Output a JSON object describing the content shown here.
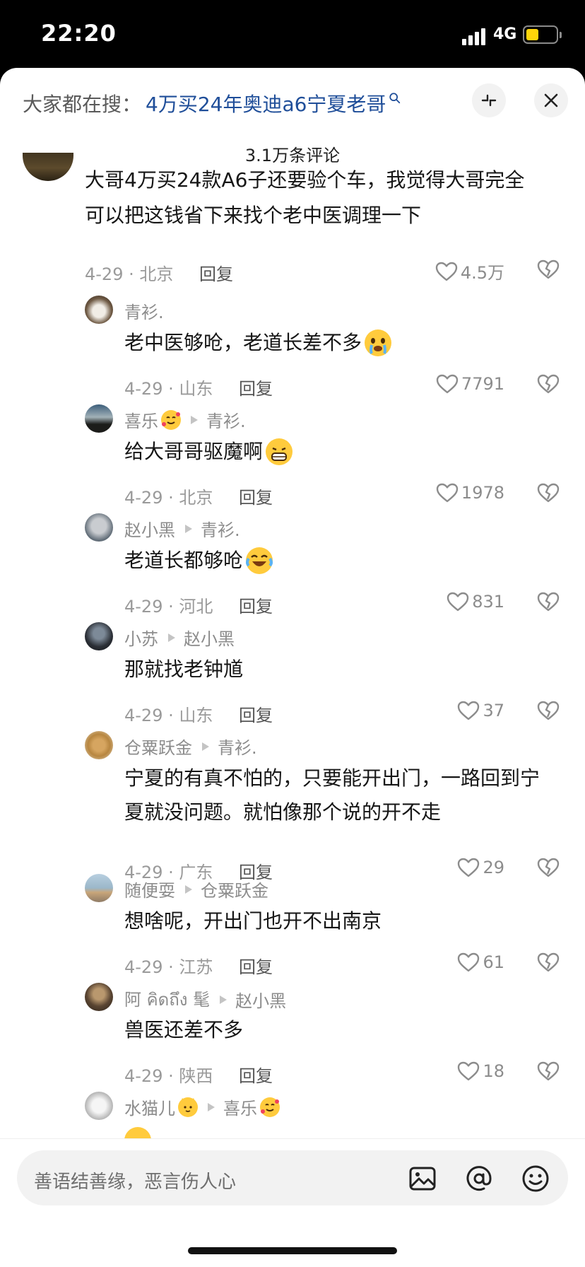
{
  "status": {
    "time": "22:20",
    "network": "4G"
  },
  "header": {
    "search_prefix": "大家都在搜：",
    "search_query": "4万买24年奥迪a6宁夏老哥",
    "comment_count": "3.1万条评论"
  },
  "comments": [
    {
      "user": "",
      "reply_to": "",
      "text": "大哥4万买24款A6子还要验个车，我觉得大哥完全",
      "text2": "可以把这钱省下来找个老中医调理一下",
      "date_loc": "4-29 · 北京",
      "reply": "回复",
      "likes": "4.5万"
    },
    {
      "user": "青衫.",
      "reply_to": "",
      "text": "老中医够呛，老道长差不多",
      "date_loc": "4-29 · 山东",
      "reply": "回复",
      "likes": "7791"
    },
    {
      "user": "喜乐",
      "reply_to": "青衫.",
      "text": "给大哥哥驱魔啊",
      "date_loc": "4-29 · 北京",
      "reply": "回复",
      "likes": "1978"
    },
    {
      "user": "赵小黑",
      "reply_to": "青衫.",
      "text": "老道长都够呛",
      "date_loc": "4-29 · 河北",
      "reply": "回复",
      "likes": "831"
    },
    {
      "user": "小苏",
      "reply_to": "赵小黑",
      "text": "那就找老钟馗",
      "date_loc": "4-29 · 山东",
      "reply": "回复",
      "likes": "37"
    },
    {
      "user": "仓粟跃金",
      "reply_to": "青衫.",
      "text": "宁夏的有真不怕的，只要能开出门，一路回到宁",
      "text2": "夏就没问题。就怕像那个说的开不走",
      "date_loc": "4-29 · 广东",
      "reply": "回复",
      "likes": "29"
    },
    {
      "user": "随便耍",
      "reply_to": "仓粟跃金",
      "text": "想啥呢，开出门也开不出南京",
      "date_loc": "4-29 · 江苏",
      "reply": "回复",
      "likes": "61"
    },
    {
      "user": "阿 คิดถึง 髦",
      "reply_to": "赵小黑",
      "text": "兽医还差不多",
      "date_loc": "4-29 · 陕西",
      "reply": "回复",
      "likes": "18"
    },
    {
      "user": "水猫儿",
      "reply_to": "喜乐"
    }
  ],
  "input": {
    "placeholder": "善语结善缘，恶言伤人心"
  },
  "icons": [
    "search-icon",
    "collapse-icon",
    "close-icon",
    "heart-icon",
    "dislike-icon",
    "play-arrow-icon",
    "image-icon",
    "mention-icon",
    "emoji-icon"
  ],
  "colors": {
    "query_blue": "#1f4e99",
    "battery_yellow": "#ffd60a",
    "gray_meta": "#9a9a9a"
  }
}
